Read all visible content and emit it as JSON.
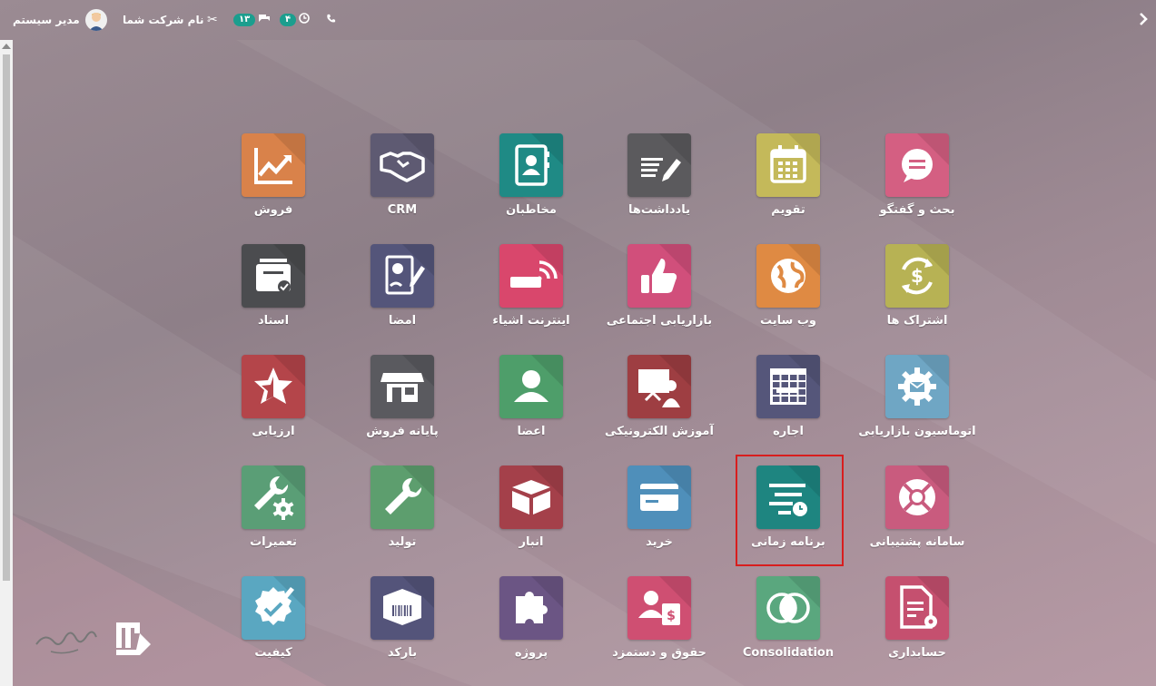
{
  "topbar": {
    "user_name": "مدیر سیستم",
    "company_name": "نام شرکت شما",
    "messages_count": "۱۳",
    "activities_count": "۴"
  },
  "apps": [
    {
      "id": "discuss",
      "label": "بحث و گفتگو",
      "color": "#d45f82",
      "icon": "chat-icon"
    },
    {
      "id": "calendar",
      "label": "تقویم",
      "color": "#c4b95a",
      "icon": "calendar-icon"
    },
    {
      "id": "notes",
      "label": "یادداشت‌ها",
      "color": "#5b5a5d",
      "icon": "notes-icon"
    },
    {
      "id": "contacts",
      "label": "مخاطبان",
      "color": "#1f8a85",
      "icon": "contacts-icon"
    },
    {
      "id": "crm",
      "label": "CRM",
      "color": "#5e5a72",
      "icon": "handshake-icon"
    },
    {
      "id": "sales",
      "label": "فروش",
      "color": "#d9824a",
      "icon": "chart-up-icon"
    },
    {
      "id": "subscriptions",
      "label": "اشتراک ها",
      "color": "#b7b254",
      "icon": "subscription-icon"
    },
    {
      "id": "website",
      "label": "وب سایت",
      "color": "#df8a43",
      "icon": "globe-icon"
    },
    {
      "id": "social",
      "label": "بازاریابی اجتماعی",
      "color": "#d14f7b",
      "icon": "thumbs-up-icon"
    },
    {
      "id": "iot",
      "label": "اینترنت اشیاء",
      "color": "#d9476c",
      "icon": "iot-icon"
    },
    {
      "id": "sign",
      "label": "امضا",
      "color": "#54557a",
      "icon": "sign-icon"
    },
    {
      "id": "documents",
      "label": "اسناد",
      "color": "#4b4c4f",
      "icon": "documents-icon"
    },
    {
      "id": "marketing_automation",
      "label": "اتوماسیون بازاریابی",
      "color": "#6fa6c4",
      "icon": "gear-mail-icon"
    },
    {
      "id": "rental",
      "label": "اجاره",
      "color": "#55567a",
      "icon": "rental-grid-icon"
    },
    {
      "id": "elearning",
      "label": "آموزش الکترونیکی",
      "color": "#9e3e42",
      "icon": "elearning-icon"
    },
    {
      "id": "members",
      "label": "اعضا",
      "color": "#4e9e6a",
      "icon": "member-icon"
    },
    {
      "id": "pos",
      "label": "پایانه فروش",
      "color": "#5a5a5f",
      "icon": "shop-icon"
    },
    {
      "id": "appraisal",
      "label": "ارزیابی",
      "color": "#b4454a",
      "icon": "star-icon"
    },
    {
      "id": "helpdesk",
      "label": "سامانه پشتیبانی",
      "color": "#c95b7e",
      "icon": "lifebuoy-icon"
    },
    {
      "id": "planning",
      "label": "برنامه زمانی",
      "color": "#1e8580",
      "icon": "planning-icon"
    },
    {
      "id": "purchase",
      "label": "خرید",
      "color": "#4f8fba",
      "icon": "card-icon"
    },
    {
      "id": "inventory",
      "label": "انبار",
      "color": "#a4404a",
      "icon": "box-icon"
    },
    {
      "id": "manufacturing",
      "label": "تولید",
      "color": "#5d9e6e",
      "icon": "wrench-icon"
    },
    {
      "id": "maintenance",
      "label": "تعمیرات",
      "color": "#5a9e76",
      "icon": "wrench-gear-icon"
    },
    {
      "id": "accounting",
      "label": "حسابداری",
      "color": "#c5506f",
      "icon": "accounting-doc-icon"
    },
    {
      "id": "consolidation",
      "label": "Consolidation",
      "color": "#5aa77e",
      "icon": "rings-icon"
    },
    {
      "id": "payroll",
      "label": "حقوق و دستمزد",
      "color": "#cf4f72",
      "icon": "payroll-icon"
    },
    {
      "id": "project",
      "label": "پروژه",
      "color": "#6b5584",
      "icon": "puzzle-icon"
    },
    {
      "id": "barcode",
      "label": "بارکد",
      "color": "#54547a",
      "icon": "barcode-box-icon"
    },
    {
      "id": "quality",
      "label": "کیفیت",
      "color": "#5aa7c1",
      "icon": "quality-icon"
    }
  ],
  "highlighted_app": "planning"
}
